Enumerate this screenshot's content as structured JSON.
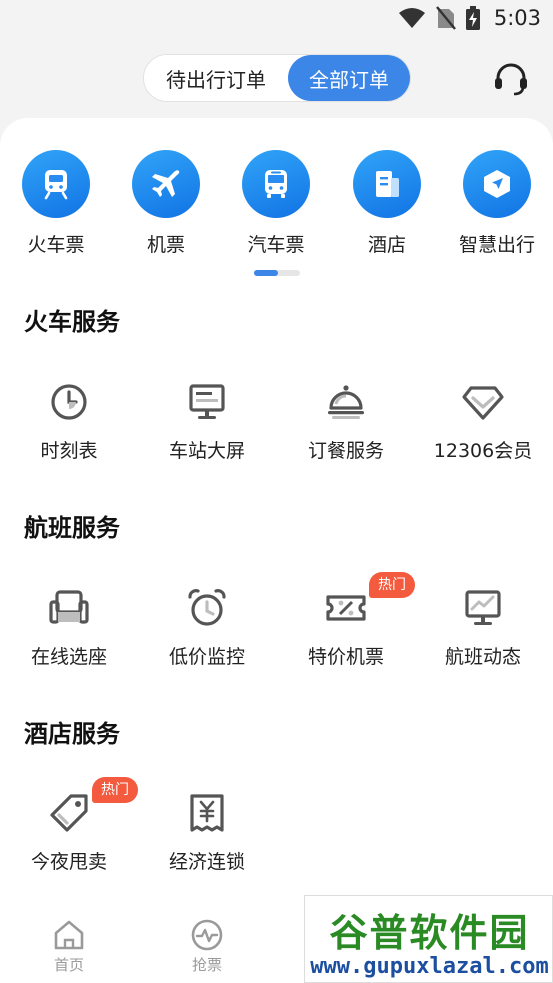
{
  "status": {
    "time": "5:03"
  },
  "header": {
    "tabs": [
      {
        "label": "待出行订单",
        "active": false
      },
      {
        "label": "全部订单",
        "active": true
      }
    ],
    "service_icon": "headset-icon"
  },
  "quick_services": [
    {
      "label": "火车票",
      "icon": "train-icon"
    },
    {
      "label": "机票",
      "icon": "plane-icon"
    },
    {
      "label": "汽车票",
      "icon": "bus-icon"
    },
    {
      "label": "酒店",
      "icon": "hotel-icon"
    },
    {
      "label": "智慧出行",
      "icon": "navigation-icon"
    }
  ],
  "sections": [
    {
      "title": "火车服务",
      "items": [
        {
          "label": "时刻表",
          "icon": "clock-icon"
        },
        {
          "label": "车站大屏",
          "icon": "monitor-icon"
        },
        {
          "label": "订餐服务",
          "icon": "cloche-icon"
        },
        {
          "label": "12306会员",
          "icon": "diamond-icon"
        }
      ]
    },
    {
      "title": "航班服务",
      "items": [
        {
          "label": "在线选座",
          "icon": "seat-icon"
        },
        {
          "label": "低价监控",
          "icon": "alarm-clock-icon"
        },
        {
          "label": "特价机票",
          "icon": "discount-ticket-icon",
          "badge": "热门"
        },
        {
          "label": "航班动态",
          "icon": "trend-monitor-icon"
        }
      ]
    },
    {
      "title": "酒店服务",
      "items": [
        {
          "label": "今夜甩卖",
          "icon": "price-tag-icon",
          "badge": "热门"
        },
        {
          "label": "经济连锁",
          "icon": "yen-receipt-icon"
        }
      ]
    }
  ],
  "tabbar": [
    {
      "label": "首页",
      "icon": "home-icon"
    },
    {
      "label": "抢票",
      "icon": "pulse-icon"
    }
  ],
  "watermark": {
    "name": "谷普软件园",
    "url": "www.gupuxlazal.com"
  },
  "colors": {
    "accent": "#3c86e8",
    "badge": "#f35a3e",
    "icon_gray": "#555555"
  }
}
